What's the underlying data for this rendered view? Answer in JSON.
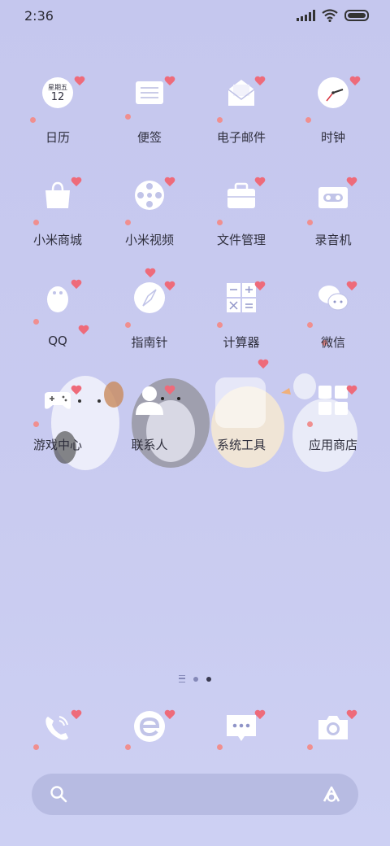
{
  "status_bar": {
    "time": "2:36"
  },
  "apps": [
    {
      "label": "日历",
      "icon": "calendar-icon",
      "cal_weekday": "星期五",
      "cal_day": "12"
    },
    {
      "label": "便签",
      "icon": "notes-icon"
    },
    {
      "label": "电子邮件",
      "icon": "email-icon"
    },
    {
      "label": "时钟",
      "icon": "clock-icon"
    },
    {
      "label": "小米商城",
      "icon": "shopping-bag-icon"
    },
    {
      "label": "小米视频",
      "icon": "video-reel-icon"
    },
    {
      "label": "文件管理",
      "icon": "file-manager-icon"
    },
    {
      "label": "录音机",
      "icon": "recorder-icon"
    },
    {
      "label": "QQ",
      "icon": "qq-penguin-icon"
    },
    {
      "label": "指南针",
      "icon": "compass-icon"
    },
    {
      "label": "计算器",
      "icon": "calculator-icon"
    },
    {
      "label": "微信",
      "icon": "wechat-icon"
    },
    {
      "label": "游戏中心",
      "icon": "gamepad-icon"
    },
    {
      "label": "联系人",
      "icon": "contacts-icon"
    },
    {
      "label": "系统工具",
      "icon": "folder-icon"
    },
    {
      "label": "应用商店",
      "icon": "app-store-icon"
    }
  ],
  "dock": [
    {
      "icon": "phone-icon"
    },
    {
      "icon": "browser-icon"
    },
    {
      "icon": "messages-icon"
    },
    {
      "icon": "camera-icon"
    }
  ],
  "colors": {
    "heart": "#ee6b7a",
    "background": "#c7c9ef",
    "search_bar": "#b7bbe2"
  }
}
